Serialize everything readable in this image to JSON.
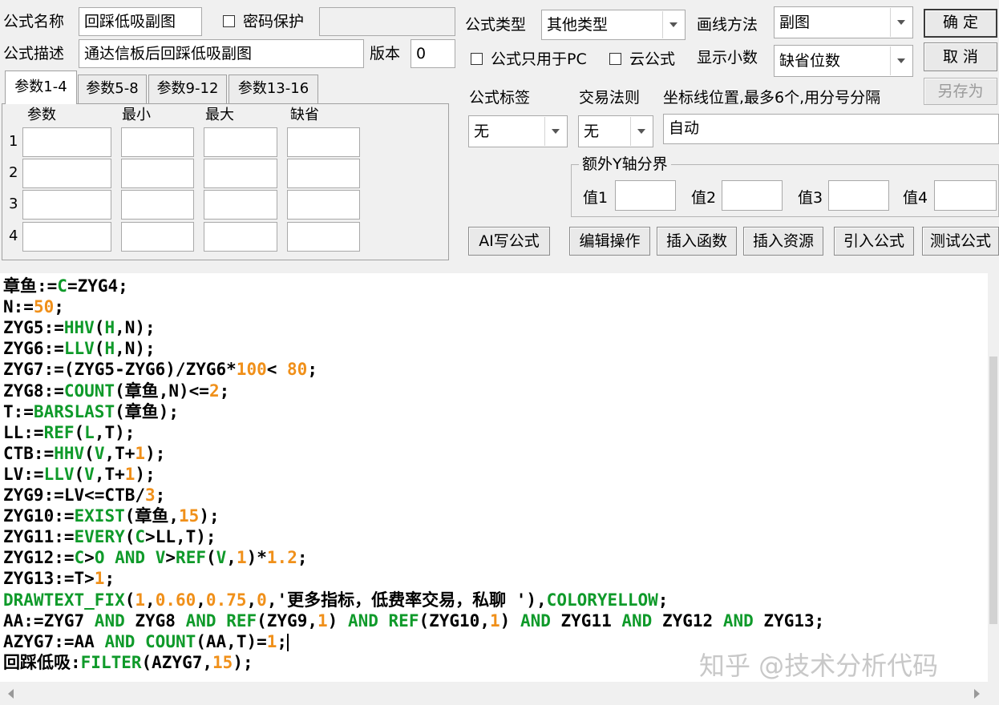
{
  "form": {
    "name_label": "公式名称",
    "name_value": "回踩低吸副图",
    "password_label": "密码保护",
    "password_value": "",
    "desc_label": "公式描述",
    "desc_value": "通达信板后回踩低吸副图",
    "version_label": "版本",
    "version_value": "0",
    "type_label": "公式类型",
    "type_value": "其他类型",
    "draw_label": "画线方法",
    "draw_value": "副图",
    "pc_only_label": "公式只用于PC",
    "cloud_label": "云公式",
    "decimals_label": "显示小数",
    "decimals_value": "缺省位数",
    "tag_label": "公式标签",
    "tag_value": "无",
    "trade_label": "交易法则",
    "trade_value": "无",
    "coord_label": "坐标线位置,最多6个,用分号分隔",
    "coord_value": "自动",
    "yaxis_label": "额外Y轴分界",
    "yvals": [
      "值1",
      "值2",
      "值3",
      "值4"
    ]
  },
  "buttons": {
    "ok": "确 定",
    "cancel": "取 消",
    "saveas": "另存为",
    "ai": "AI写公式",
    "edit": "编辑操作",
    "insert_fn": "插入函数",
    "insert_res": "插入资源",
    "import": "引入公式",
    "test": "测试公式"
  },
  "tabs": [
    "参数1-4",
    "参数5-8",
    "参数9-12",
    "参数13-16"
  ],
  "params": {
    "headers": [
      "参数",
      "最小",
      "最大",
      "缺省"
    ],
    "rows": [
      "1",
      "2",
      "3",
      "4"
    ]
  },
  "code_lines": [
    [
      [
        "章鱼:=",
        "op"
      ],
      [
        "C",
        "fn"
      ],
      [
        "=ZYG4;",
        "op"
      ]
    ],
    [
      [
        "N:=",
        "op"
      ],
      [
        "50",
        "nm"
      ],
      [
        ";",
        "op"
      ]
    ],
    [
      [
        "ZYG5:=",
        "op"
      ],
      [
        "HHV",
        "fn"
      ],
      [
        "(",
        "op"
      ],
      [
        "H",
        "fn"
      ],
      [
        ",N);",
        "op"
      ]
    ],
    [
      [
        "ZYG6:=",
        "op"
      ],
      [
        "LLV",
        "fn"
      ],
      [
        "(",
        "op"
      ],
      [
        "H",
        "fn"
      ],
      [
        ",N);",
        "op"
      ]
    ],
    [
      [
        "ZYG7:=(ZYG5-ZYG6)/ZYG6*",
        "op"
      ],
      [
        "100",
        "nm"
      ],
      [
        "< ",
        "op"
      ],
      [
        "80",
        "nm"
      ],
      [
        ";",
        "op"
      ]
    ],
    [
      [
        "ZYG8:=",
        "op"
      ],
      [
        "COUNT",
        "fn"
      ],
      [
        "(章鱼,N)<=",
        "op"
      ],
      [
        "2",
        "nm"
      ],
      [
        ";",
        "op"
      ]
    ],
    [
      [
        "T:=",
        "op"
      ],
      [
        "BARSLAST",
        "fn"
      ],
      [
        "(章鱼);",
        "op"
      ]
    ],
    [
      [
        "LL:=",
        "op"
      ],
      [
        "REF",
        "fn"
      ],
      [
        "(",
        "op"
      ],
      [
        "L",
        "fn"
      ],
      [
        ",T);",
        "op"
      ]
    ],
    [
      [
        "CTB:=",
        "op"
      ],
      [
        "HHV",
        "fn"
      ],
      [
        "(",
        "op"
      ],
      [
        "V",
        "fn"
      ],
      [
        ",T+",
        "op"
      ],
      [
        "1",
        "nm"
      ],
      [
        ");",
        "op"
      ]
    ],
    [
      [
        "LV:=",
        "op"
      ],
      [
        "LLV",
        "fn"
      ],
      [
        "(",
        "op"
      ],
      [
        "V",
        "fn"
      ],
      [
        ",T+",
        "op"
      ],
      [
        "1",
        "nm"
      ],
      [
        ");",
        "op"
      ]
    ],
    [
      [
        "ZYG9:=LV<=CTB/",
        "op"
      ],
      [
        "3",
        "nm"
      ],
      [
        ";",
        "op"
      ]
    ],
    [
      [
        "ZYG10:=",
        "op"
      ],
      [
        "EXIST",
        "fn"
      ],
      [
        "(章鱼,",
        "op"
      ],
      [
        "15",
        "nm"
      ],
      [
        ");",
        "op"
      ]
    ],
    [
      [
        "ZYG11:=",
        "op"
      ],
      [
        "EVERY",
        "fn"
      ],
      [
        "(",
        "op"
      ],
      [
        "C",
        "fn"
      ],
      [
        ">LL,T);",
        "op"
      ]
    ],
    [
      [
        "ZYG12:=",
        "op"
      ],
      [
        "C",
        "fn"
      ],
      [
        ">",
        "op"
      ],
      [
        "O",
        "fn"
      ],
      [
        " ",
        "op"
      ],
      [
        "AND",
        "fn"
      ],
      [
        " ",
        "op"
      ],
      [
        "V",
        "fn"
      ],
      [
        ">",
        "op"
      ],
      [
        "REF",
        "fn"
      ],
      [
        "(",
        "op"
      ],
      [
        "V",
        "fn"
      ],
      [
        ",",
        "op"
      ],
      [
        "1",
        "nm"
      ],
      [
        ")*",
        "op"
      ],
      [
        "1.2",
        "nm"
      ],
      [
        ";",
        "op"
      ]
    ],
    [
      [
        "ZYG13:=T>",
        "op"
      ],
      [
        "1",
        "nm"
      ],
      [
        ";",
        "op"
      ]
    ],
    [
      [
        "DRAWTEXT_FIX",
        "fn"
      ],
      [
        "(",
        "op"
      ],
      [
        "1",
        "nm"
      ],
      [
        ",",
        "op"
      ],
      [
        "0.60",
        "nm"
      ],
      [
        ",",
        "op"
      ],
      [
        "0.75",
        "nm"
      ],
      [
        ",",
        "op"
      ],
      [
        "0",
        "nm"
      ],
      [
        ",'更多指标，低费率交易，私聊 '),",
        "op"
      ],
      [
        "COLORYELLOW",
        "fn"
      ],
      [
        ";",
        "op"
      ]
    ],
    [
      [
        "AA:=ZYG7 ",
        "op"
      ],
      [
        "AND",
        "fn"
      ],
      [
        " ZYG8 ",
        "op"
      ],
      [
        "AND",
        "fn"
      ],
      [
        " ",
        "op"
      ],
      [
        "REF",
        "fn"
      ],
      [
        "(ZYG9,",
        "op"
      ],
      [
        "1",
        "nm"
      ],
      [
        ") ",
        "op"
      ],
      [
        "AND",
        "fn"
      ],
      [
        " ",
        "op"
      ],
      [
        "REF",
        "fn"
      ],
      [
        "(ZYG10,",
        "op"
      ],
      [
        "1",
        "nm"
      ],
      [
        ") ",
        "op"
      ],
      [
        "AND",
        "fn"
      ],
      [
        " ZYG11 ",
        "op"
      ],
      [
        "AND",
        "fn"
      ],
      [
        " ZYG12 ",
        "op"
      ],
      [
        "AND",
        "fn"
      ],
      [
        " ZYG13;",
        "op"
      ]
    ],
    [
      [
        "AZYG7:=AA ",
        "op"
      ],
      [
        "AND",
        "fn"
      ],
      [
        " ",
        "op"
      ],
      [
        "COUNT",
        "fn"
      ],
      [
        "(AA,T)=",
        "op"
      ],
      [
        "1",
        "nm"
      ],
      [
        ";",
        "op"
      ]
    ],
    [
      [
        "回踩低吸:",
        "op"
      ],
      [
        "FILTER",
        "fn"
      ],
      [
        "(AZYG7,",
        "op"
      ],
      [
        "15",
        "nm"
      ],
      [
        ");",
        "op"
      ]
    ]
  ],
  "watermark": "知乎 @技术分析代码"
}
